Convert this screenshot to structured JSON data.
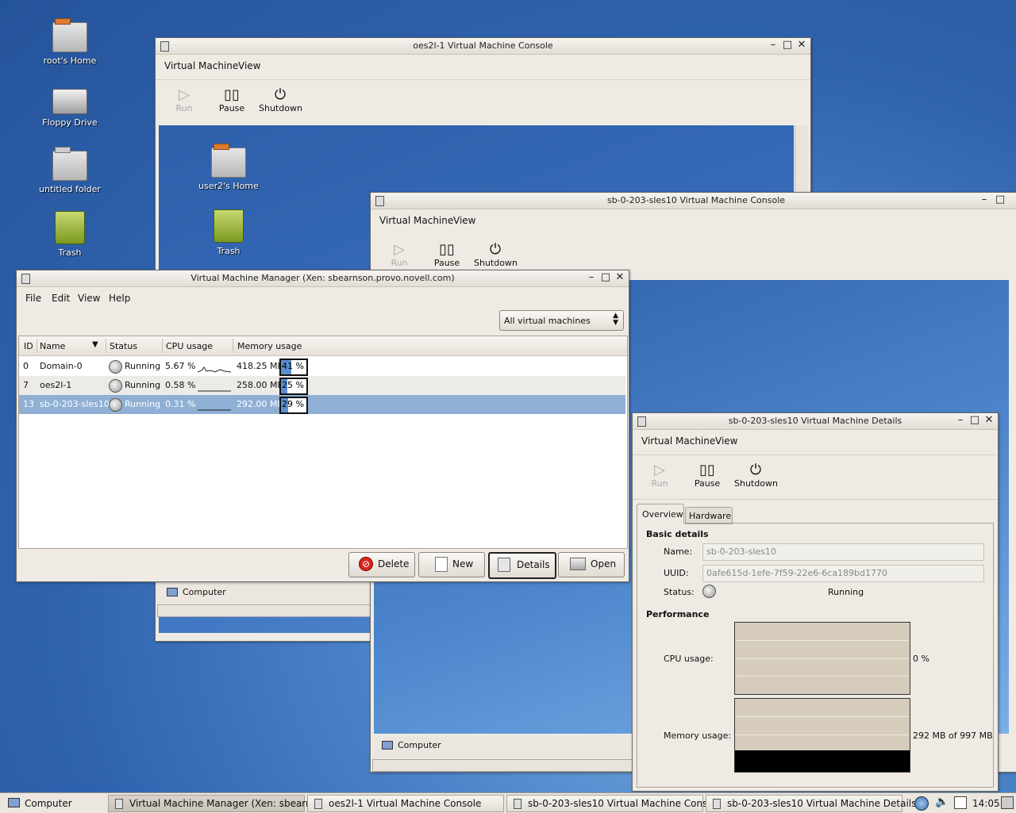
{
  "desktop": {
    "icons": [
      {
        "label": "root's Home"
      },
      {
        "label": "Floppy Drive"
      },
      {
        "label": "untitled folder"
      },
      {
        "label": "Trash"
      }
    ]
  },
  "console1": {
    "title": "oes2l-1 Virtual Machine Console",
    "menu": [
      "Virtual Machine",
      "View"
    ],
    "tools": [
      "Run",
      "Pause",
      "Shutdown"
    ],
    "guest_icons": [
      "user2's Home",
      "Trash"
    ],
    "taskbar_item": "Computer"
  },
  "console2": {
    "title": "sb-0-203-sles10 Virtual Machine Console",
    "menu": [
      "Virtual Machine",
      "View"
    ],
    "tools": [
      "Run",
      "Pause",
      "Shutdown"
    ],
    "taskbar_item": "Computer"
  },
  "manager": {
    "title": "Virtual Machine Manager (Xen: sbearnson.provo.novell.com)",
    "menu": [
      "File",
      "Edit",
      "View",
      "Help"
    ],
    "filter": "All virtual machines",
    "columns": [
      "ID",
      "Name",
      "Status",
      "CPU usage",
      "Memory usage"
    ],
    "rows": [
      {
        "id": "0",
        "name": "Domain-0",
        "status": "Running",
        "cpu": "5.67 %",
        "mem": "418.25 MB",
        "mem_pct": "41 %",
        "mem_frac": 0.41
      },
      {
        "id": "7",
        "name": "oes2l-1",
        "status": "Running",
        "cpu": "0.58 %",
        "mem": "258.00 MB",
        "mem_pct": "25 %",
        "mem_frac": 0.25
      },
      {
        "id": "13",
        "name": "sb-0-203-sles10",
        "status": "Running",
        "cpu": "0.31 %",
        "mem": "292.00 MB",
        "mem_pct": "29 %",
        "mem_frac": 0.29
      }
    ],
    "buttons": [
      "Delete",
      "New",
      "Details",
      "Open"
    ],
    "selected_row": 2,
    "accent": "#8fb0d4"
  },
  "details": {
    "title": "sb-0-203-sles10 Virtual Machine Details",
    "menu": [
      "Virtual Machine",
      "View"
    ],
    "tools": [
      "Run",
      "Pause",
      "Shutdown"
    ],
    "tabs": [
      "Overview",
      "Hardware"
    ],
    "basic_heading": "Basic details",
    "name_label": "Name:",
    "name_value": "sb-0-203-sles10",
    "uuid_label": "UUID:",
    "uuid_value": "0afe615d-1efe-7f59-22e6-6ca189bd1770",
    "status_label": "Status:",
    "status_value": "Running",
    "perf_heading": "Performance",
    "cpu_label": "CPU usage:",
    "cpu_value": "0 %",
    "mem_label": "Memory usage:",
    "mem_value": "292 MB of 997 MB",
    "mem_frac": 0.29
  },
  "taskbar": {
    "start": "Computer",
    "tasks": [
      "Virtual Machine Manager (Xen: sbearnso...",
      "oes2l-1 Virtual Machine Console",
      "sb-0-203-sles10 Virtual Machine Console",
      "sb-0-203-sles10 Virtual Machine Details"
    ],
    "clock": "14:05"
  }
}
